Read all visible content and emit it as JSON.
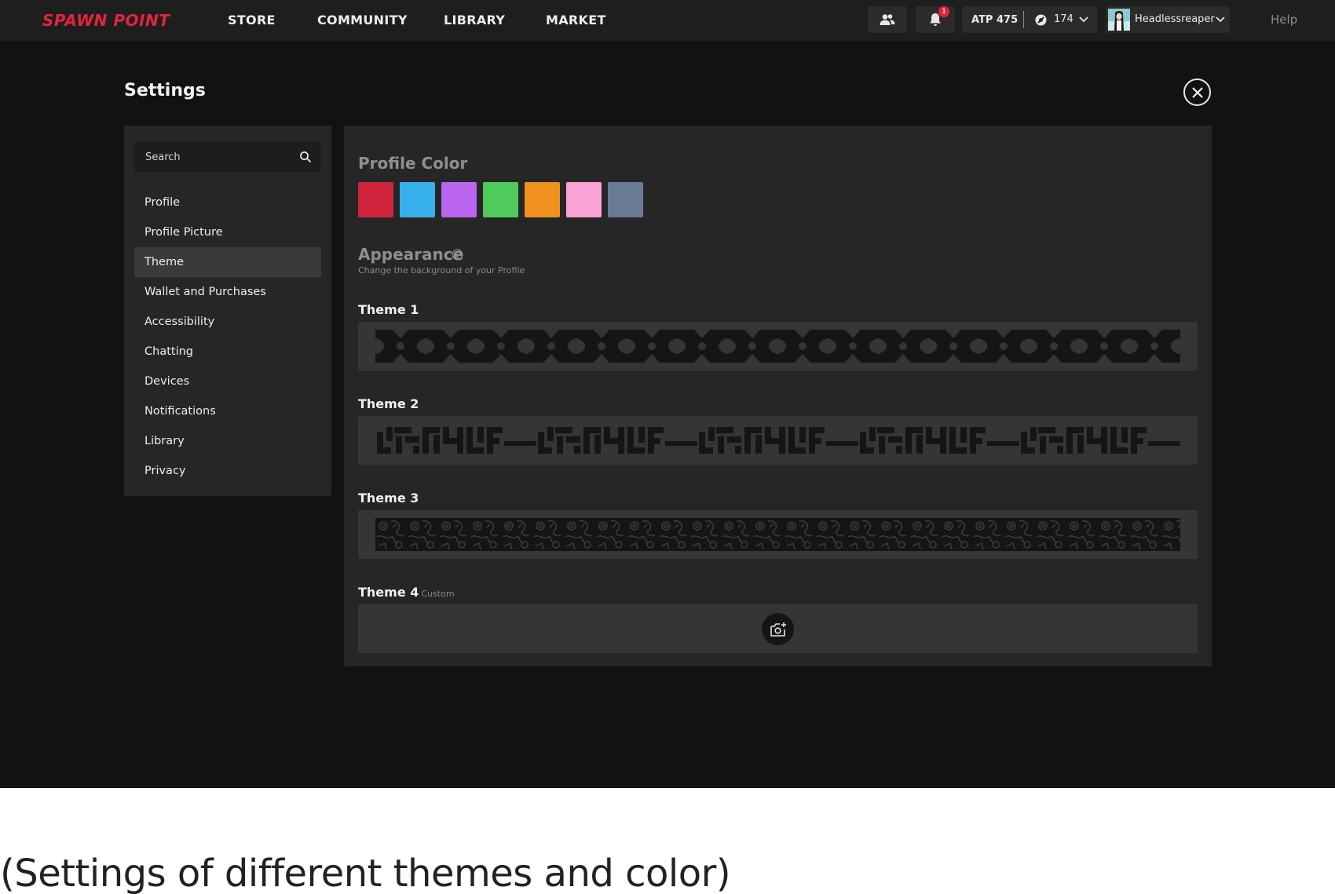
{
  "brand": {
    "logo_text": "SPAWN POINT",
    "accent": "#e0263d"
  },
  "nav": {
    "items": [
      "STORE",
      "COMMUNITY",
      "LIBRARY",
      "MARKET"
    ]
  },
  "header": {
    "notification_count": "1",
    "atp_label": "ATP 475",
    "coin_value": "174",
    "username": "Headlessreaper",
    "help_label": "Help",
    "icons": [
      "friends-icon",
      "bell-icon",
      "coin-icon",
      "chevron-down-icon",
      "avatar"
    ]
  },
  "settings": {
    "title": "Settings",
    "search": {
      "placeholder": "Search",
      "value": ""
    },
    "sidebar_items": [
      {
        "label": "Profile"
      },
      {
        "label": "Profile Picture"
      },
      {
        "label": "Theme",
        "active": true
      },
      {
        "label": "Wallet and Purchases"
      },
      {
        "label": "Accessibility"
      },
      {
        "label": "Chatting"
      },
      {
        "label": "Devices"
      },
      {
        "label": "Notifications"
      },
      {
        "label": "Library"
      },
      {
        "label": "Privacy"
      }
    ]
  },
  "profile_color": {
    "title": "Profile Color",
    "swatches": [
      "#d0253d",
      "#38b0ec",
      "#b965f0",
      "#4fca5c",
      "#f0911f",
      "#f8a2d6",
      "#6a7b96"
    ]
  },
  "appearance": {
    "title": "Appearance",
    "subtitle": "Change the background of your Profile",
    "themes": [
      {
        "label": "Theme 1",
        "tag": ""
      },
      {
        "label": "Theme 2",
        "tag": ""
      },
      {
        "label": "Theme 3",
        "tag": ""
      },
      {
        "label": "Theme 4",
        "tag": "Custom"
      }
    ]
  },
  "caption": "(Settings of different themes and color)"
}
